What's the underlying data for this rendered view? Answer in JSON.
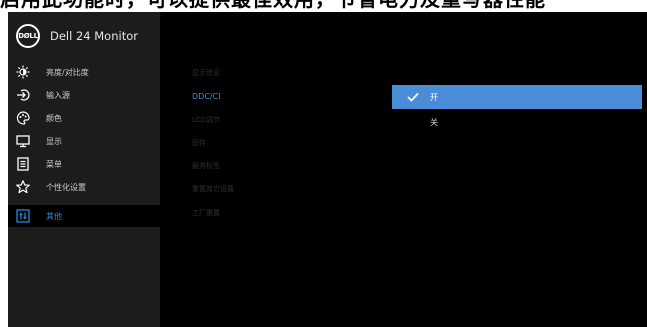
{
  "caption": "启用此功能时，可以提供最佳效用，节省电力及重写器性能",
  "brand": {
    "logo_text": "DØLL",
    "model": "Dell 24 Monitor"
  },
  "menu": [
    {
      "label": "亮度/对比度",
      "icon": "brightness-icon"
    },
    {
      "label": "输入源",
      "icon": "input-source-icon"
    },
    {
      "label": "颜色",
      "icon": "palette-icon"
    },
    {
      "label": "显示",
      "icon": "display-icon"
    },
    {
      "label": "菜单",
      "icon": "menu-list-icon"
    },
    {
      "label": "个性化设置",
      "icon": "star-icon"
    },
    {
      "label": "其他",
      "icon": "other-settings-icon",
      "active": true
    }
  ],
  "submenu": [
    "显示信息",
    "DDC/CI",
    "LCD调节",
    "固件",
    "服务标签",
    "重置其它设置",
    "工厂重置"
  ],
  "options": [
    {
      "label": "开",
      "selected": true
    },
    {
      "label": "关",
      "selected": false
    }
  ],
  "colors": {
    "accent": "#3c8fdc",
    "selected_bg": "#4a8dd6",
    "sidebar_bg": "#1c1c1c",
    "panel_bg": "#000000"
  }
}
